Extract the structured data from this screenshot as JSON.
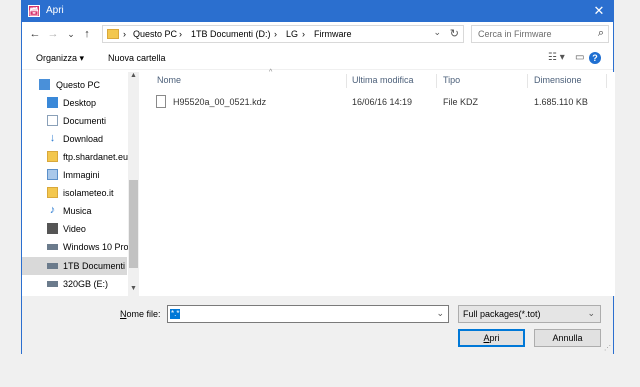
{
  "window": {
    "title": "Apri",
    "app_icon_glyph": "🗃",
    "close_glyph": "✕"
  },
  "nav_buttons": {
    "back": "←",
    "forward": "→",
    "history": "⌄",
    "up": "↑"
  },
  "address": {
    "crumbs": [
      "Questo PC",
      "1TB Documenti (D:)",
      "LG",
      "Firmware"
    ],
    "separator": "›",
    "dropdown_glyph": "⌄",
    "refresh_glyph": "↻"
  },
  "search": {
    "placeholder": "Cerca in Firmware",
    "icon_glyph": "⌕"
  },
  "toolbar": {
    "organize": "Organizza ▾",
    "new_folder": "Nuova cartella",
    "view_glyph": "☷ ▾",
    "pane_glyph": "▭",
    "help_glyph": "?"
  },
  "sidebar": {
    "items": [
      {
        "label": "Questo PC",
        "icon": "computer-icon",
        "color": "#4a90d9"
      },
      {
        "label": "Desktop",
        "icon": "desktop-icon",
        "color": "#3a88d8"
      },
      {
        "label": "Documenti",
        "icon": "documents-icon",
        "color": "#8aa0b8"
      },
      {
        "label": "Download",
        "icon": "download-icon",
        "color": "#2b7bd1"
      },
      {
        "label": "ftp.shardanet.eu",
        "icon": "network-folder-icon",
        "color": "#d9a83b"
      },
      {
        "label": "Immagini",
        "icon": "pictures-icon",
        "color": "#5a8fc9"
      },
      {
        "label": "isolameteo.it",
        "icon": "network-folder-icon",
        "color": "#d9a83b"
      },
      {
        "label": "Musica",
        "icon": "music-icon",
        "color": "#2b7bd1"
      },
      {
        "label": "Video",
        "icon": "video-icon",
        "color": "#555555"
      },
      {
        "label": "Windows 10 Pro",
        "icon": "drive-icon",
        "color": "#6b7b8c"
      },
      {
        "label": "1TB Documenti",
        "icon": "drive-icon",
        "color": "#6b7b8c"
      },
      {
        "label": "320GB (E:)",
        "icon": "drive-icon",
        "color": "#6b7b8c"
      }
    ],
    "selected_index": 10,
    "scroll_up": "▲",
    "scroll_down": "▼"
  },
  "filelist": {
    "sort_glyph": "^",
    "columns": [
      "Nome",
      "Ultima modifica",
      "Tipo",
      "Dimensione"
    ],
    "rows": [
      {
        "name": "H95520a_00_0521.kdz",
        "modified": "16/06/16 14:19",
        "type": "File KDZ",
        "size": "1.685.110 KB"
      }
    ]
  },
  "bottom": {
    "filename_label_underlined": "N",
    "filename_label_rest": "ome file:",
    "filename_value": "*.*",
    "filename_dropdown": "⌄",
    "filetype_value": "Full packages(*.tot)",
    "filetype_dropdown": "⌄",
    "open_label_underlined": "A",
    "open_label_rest": "pri",
    "cancel_label": "Annulla",
    "grip": "⋰"
  }
}
